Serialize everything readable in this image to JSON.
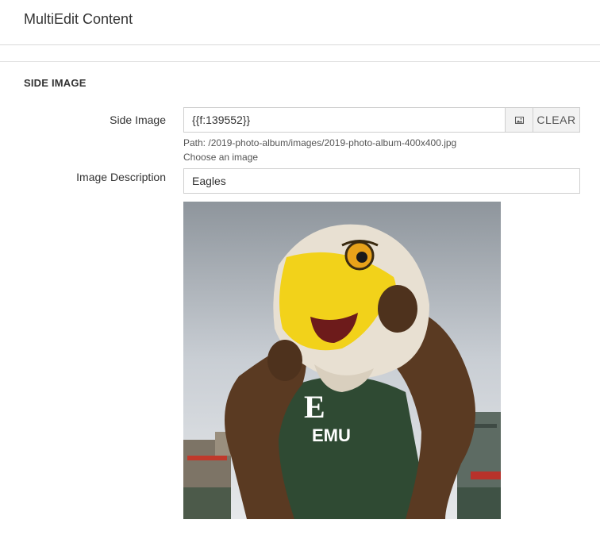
{
  "header": {
    "title": "MultiEdit Content"
  },
  "section": {
    "title": "SIDE IMAGE"
  },
  "side_image": {
    "label": "Side Image",
    "value": "{{f:139552}}",
    "picker_icon": "image-icon",
    "clear_label": "CLEAR",
    "path_text": "Path: /2019-photo-album/images/2019-photo-album-400x400.jpg",
    "choose_text": "Choose an image"
  },
  "image_description": {
    "label": "Image Description",
    "value": "Eagles"
  },
  "preview": {
    "alt": "Eagles",
    "shirt_letter": "E",
    "shirt_text": "EMU",
    "colors": {
      "sky": "#c9ced4",
      "feathers": "#e8e0d2",
      "beak": "#f2d21a",
      "fur": "#5a3a22",
      "shirt": "#2f4a33"
    }
  }
}
